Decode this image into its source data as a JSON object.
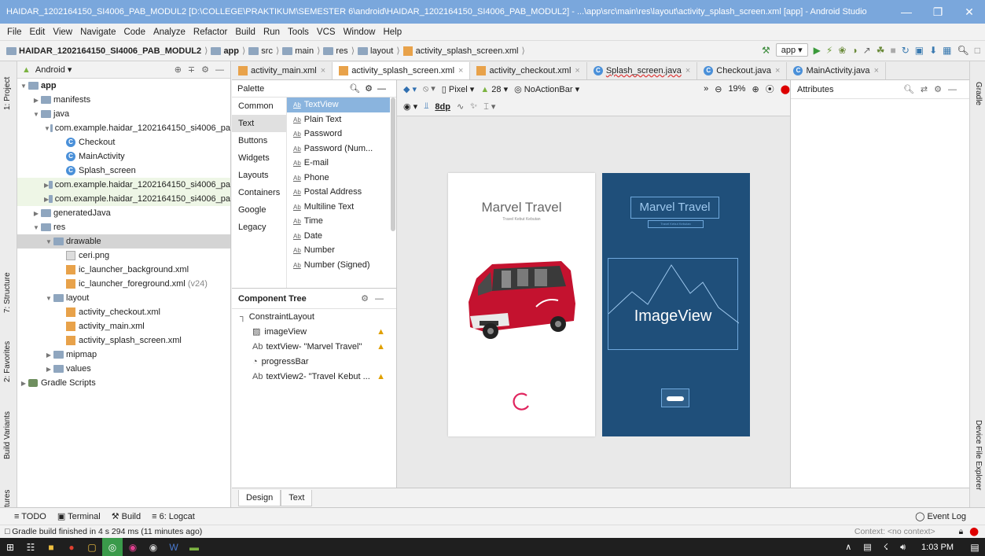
{
  "window": {
    "title": "HAIDAR_1202164150_SI4006_PAB_MODUL2 [D:\\COLLEGE\\PRAKTIKUM\\SEMESTER 6\\android\\HAIDAR_1202164150_SI4006_PAB_MODUL2] - ...\\app\\src\\main\\res\\layout\\activity_splash_screen.xml [app] - Android Studio"
  },
  "menu": [
    "File",
    "Edit",
    "View",
    "Navigate",
    "Code",
    "Analyze",
    "Refactor",
    "Build",
    "Run",
    "Tools",
    "VCS",
    "Window",
    "Help"
  ],
  "breadcrumb": [
    "HAIDAR_1202164150_SI4006_PAB_MODUL2",
    "app",
    "src",
    "main",
    "res",
    "layout",
    "activity_splash_screen.xml"
  ],
  "run_config": "app",
  "left_tool_tabs": [
    "1: Project",
    "7: Structure",
    "2: Favorites",
    "Build Variants",
    "Layout Captures"
  ],
  "right_tool_tabs": [
    "Gradle",
    "Device File Explorer"
  ],
  "project": {
    "view_mode": "Android",
    "tree": [
      {
        "label": "app",
        "level": 0,
        "icon": "app"
      },
      {
        "label": "manifests",
        "level": 1,
        "icon": "folder"
      },
      {
        "label": "java",
        "level": 1,
        "icon": "folder"
      },
      {
        "label": "com.example.haidar_1202164150_si4006_pa",
        "level": 2,
        "icon": "package"
      },
      {
        "label": "Checkout",
        "level": 3,
        "icon": "class"
      },
      {
        "label": "MainActivity",
        "level": 3,
        "icon": "class"
      },
      {
        "label": "Splash_screen",
        "level": 3,
        "icon": "class"
      },
      {
        "label": "com.example.haidar_1202164150_si4006_pa",
        "level": 2,
        "icon": "package"
      },
      {
        "label": "com.example.haidar_1202164150_si4006_pa",
        "level": 2,
        "icon": "package"
      },
      {
        "label": "generatedJava",
        "level": 1,
        "icon": "folder"
      },
      {
        "label": "res",
        "level": 1,
        "icon": "folder"
      },
      {
        "label": "drawable",
        "level": 2,
        "icon": "folder"
      },
      {
        "label": "ceri.png",
        "level": 3,
        "icon": "file"
      },
      {
        "label": "ic_launcher_background.xml",
        "level": 3,
        "icon": "xml"
      },
      {
        "label": "ic_launcher_foreground.xml",
        "level": 3,
        "icon": "xml",
        "suffix": "(v24)"
      },
      {
        "label": "layout",
        "level": 2,
        "icon": "folder"
      },
      {
        "label": "activity_checkout.xml",
        "level": 3,
        "icon": "xml"
      },
      {
        "label": "activity_main.xml",
        "level": 3,
        "icon": "xml"
      },
      {
        "label": "activity_splash_screen.xml",
        "level": 3,
        "icon": "xml"
      },
      {
        "label": "mipmap",
        "level": 2,
        "icon": "folder"
      },
      {
        "label": "values",
        "level": 2,
        "icon": "folder"
      },
      {
        "label": "Gradle Scripts",
        "level": 0,
        "icon": "gradle"
      }
    ]
  },
  "editor_tabs": [
    {
      "label": "activity_main.xml",
      "active": false
    },
    {
      "label": "activity_splash_screen.xml",
      "active": true
    },
    {
      "label": "activity_checkout.xml",
      "active": false
    },
    {
      "label": "Splash_screen.java",
      "active": false
    },
    {
      "label": "Checkout.java",
      "active": false
    },
    {
      "label": "MainActivity.java",
      "active": false
    }
  ],
  "palette": {
    "title": "Palette",
    "categories": [
      "Common",
      "Text",
      "Buttons",
      "Widgets",
      "Layouts",
      "Containers",
      "Google",
      "Legacy"
    ],
    "active_category": "Text",
    "items": [
      "TextView",
      "Plain Text",
      "Password",
      "Password (Num...",
      "E-mail",
      "Phone",
      "Postal Address",
      "Multiline Text",
      "Time",
      "Date",
      "Number",
      "Number (Signed)"
    ]
  },
  "component_tree": {
    "title": "Component Tree",
    "items": [
      {
        "label": "ConstraintLayout",
        "warn": false
      },
      {
        "label": "imageView",
        "warn": true
      },
      {
        "label": "textView- \"Marvel Travel\"",
        "warn": true
      },
      {
        "label": "progressBar",
        "warn": false
      },
      {
        "label": "textView2- \"Travel Kebut ...",
        "warn": true
      }
    ]
  },
  "design_toolbar": {
    "device": "Pixel",
    "api": "28",
    "theme": "NoActionBar",
    "zoom": "19%",
    "margin": "8dp"
  },
  "preview": {
    "title": "Marvel Travel",
    "subtitle": "Travel Kebut Kebutan",
    "image_placeholder": "ImageView"
  },
  "attributes": {
    "title": "Attributes"
  },
  "design_tabs": [
    "Design",
    "Text"
  ],
  "bottom_tools": [
    "TODO",
    "Terminal",
    "Build",
    "6: Logcat"
  ],
  "event_log": "Event Log",
  "status": {
    "message": "Gradle build finished in 4 s 294 ms (11 minutes ago)",
    "context": "Context: <no context>"
  },
  "taskbar": {
    "time": "1:03 PM"
  },
  "colors": {
    "title_bar": "#7aa7dc",
    "blueprint": "#1f4f7a",
    "progress": "#e0245e",
    "van": "#c4122f"
  }
}
